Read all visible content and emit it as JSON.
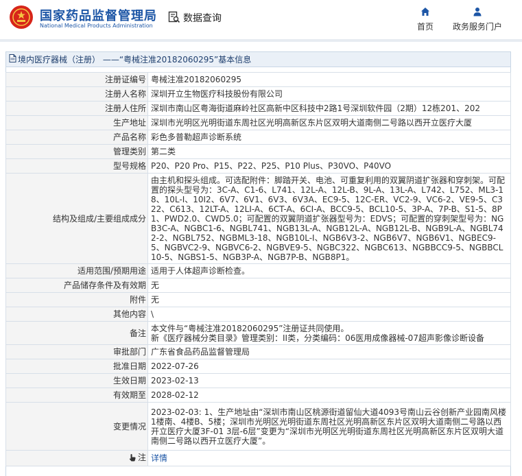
{
  "header": {
    "brand_cn": "国家药品监督管理局",
    "brand_en": "National Medical Products Administration",
    "query_label": "数据查询",
    "nav": [
      {
        "label": "首页",
        "icon": "home-icon"
      },
      {
        "label": "政务服务门户",
        "icon": "user-icon"
      }
    ]
  },
  "panel": {
    "title": "境内医疗器械（注册） ——“粤械注准20182060295”基本信息"
  },
  "rows": [
    {
      "label": "注册证编号",
      "value": "粤械注准20182060295"
    },
    {
      "label": "注册人名称",
      "value": "深圳开立生物医疗科技股份有限公司"
    },
    {
      "label": "注册人住所",
      "value": "深圳市南山区粤海街道麻岭社区高新中区科技中2路1号深圳软件园（2期）12栋201、202"
    },
    {
      "label": "生产地址",
      "value": "深圳市光明区光明街道东周社区光明高新区东片区双明大道南侧二号路以西开立医疗大厦"
    },
    {
      "label": "产品名称",
      "value": "彩色多普勒超声诊断系统"
    },
    {
      "label": "管理类别",
      "value": "第二类"
    },
    {
      "label": "型号规格",
      "value": "P20、P20 Pro、P15、P22、P25、P10 Plus、P30VO、P40VO"
    },
    {
      "label": "结构及组成/主要组成成分",
      "value": "由主机和探头组成。可选配附件：脚踏开关、电池、可重复利用的双翼阴道扩张器和穿刺架。可配置的探头型号为：3C-A、C1-6、L741、12L-A、12L-B、9L-A、13L-A、L742、L752、ML3-18、10L-I、10I2、6V7、6V1、6V3、6V3A、EC9-5、12C-ER、VC2-9、VC6-2、VE9-5、C322、C613、12LT-A、12LI-A、6CT-A、6CI-A、BCC9-5、BCL10-5、3P-A、7P-B、S1-5、8P1、PWD2.0、CWD5.0；可配置的双翼阴道扩张器型号为：EDVS；可配置的穿刺架型号为：NGB3C-A、NGBC1-6、NGBL741、NGB13L-A、NGB12L-A、NGB12L-B、NGB9L-A、NGBL742-2、NGBL752、NGBML3-18、NGB10L-I、NGB6V3-2、NGB6V7、NGB6V1、NGBEC9-5、NGBVC2-9、NGBVC6-2、NGBVE9-5、NGBC322、NGBC613、NGBBCC9-5、NGBBCL10-5、NGBS1-5、NGB3P-A、NGB7P-B、NGB8P1。"
    },
    {
      "label": "适用范围/预期用途",
      "value": "适用于人体超声诊断检查。"
    },
    {
      "label": "产品储存条件及有效期",
      "value": "无"
    },
    {
      "label": "附件",
      "value": "无"
    },
    {
      "label": "其他内容",
      "value": "\\"
    },
    {
      "label": "备注",
      "value": "本文件与“粤械注准20182060295”注册证共同使用。",
      "value2": "新《医疗器械分类目录》管理类别：II类，分类编码：06医用成像器械-07超声影像诊断设备"
    },
    {
      "label": "审批部门",
      "value": "广东省食品药品监督管理局"
    },
    {
      "label": "批准日期",
      "value": "2022-07-26"
    },
    {
      "label": "生效日期",
      "value": "2023-02-13"
    },
    {
      "label": "有效期至",
      "value": "2028-02-12"
    },
    {
      "label": "变更情况",
      "value": "2023-02-03: 1、生产地址由“深圳市南山区桃源街道留仙大道4093号南山云谷创新产业园南风楼1楼南、4楼B、5楼；深圳市光明区光明街道东周社区光明高新区东片区双明大道南侧二号路以西开立医疗大厦3F-01 3层-6层”变更为“深圳市光明区光明街道东周社区光明高新区东片区双明大道南侧二号路以西开立医疗大厦”。"
    },
    {
      "label": "注",
      "value": "详情"
    }
  ],
  "colors": {
    "brand_blue": "#1d56a6",
    "logo_red": "#d7261a",
    "label_bg": "#f4f4f4",
    "title_bg": "#eaf0f7",
    "border": "#d7dfe8"
  }
}
